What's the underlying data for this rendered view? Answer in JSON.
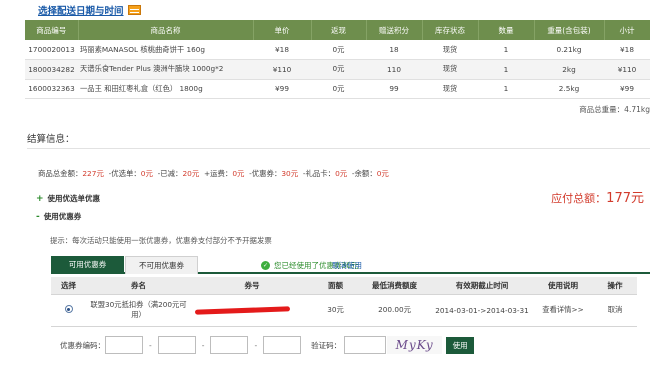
{
  "delivery_link": "选择配送日期与时间",
  "cart": {
    "headers": [
      "商品编号",
      "商品名称",
      "单价",
      "返现",
      "赠送积分",
      "库存状态",
      "数量",
      "重量(含包装)",
      "小计"
    ],
    "rows": [
      [
        "1700020013",
        "玛丽素MANASOL 核桃曲奇饼干 160g",
        "¥18",
        "0元",
        "18",
        "现货",
        "1",
        "0.21kg",
        "¥18"
      ],
      [
        "1800034282",
        "天谱乐食Tender Plus 澳洲牛腩块 1000g*2",
        "¥110",
        "0元",
        "110",
        "现货",
        "1",
        "2kg",
        "¥110"
      ],
      [
        "1600032363",
        "一品王 和田红枣礼盒（红色） 1800g",
        "¥99",
        "0元",
        "99",
        "现货",
        "1",
        "2.5kg",
        "¥99"
      ]
    ],
    "total_weight": "商品总重量：4.71kg"
  },
  "settle": {
    "title": "结算信息：",
    "summary": {
      "goods_label": "商品总金额：",
      "goods_value": "227元",
      "discount_label": "-优选单：",
      "discount_value": "0元",
      "cut_label": "-已减：",
      "cut_value": "20元",
      "shipping_label": "+运费：",
      "shipping_value": "0元",
      "coupon_label": "-优惠券：",
      "coupon_value": "30元",
      "giftcard_label": "-礼品卡：",
      "giftcard_value": "0元",
      "balance_label": "-余额：",
      "balance_value": "0元"
    },
    "use_order_coupon": "使用优选单优惠",
    "use_coupon": "使用优惠券",
    "due_label": "应付总额：",
    "due_value": "177元",
    "hint": "提示：每次活动只能使用一张优惠券，优惠券支付部分不予开据发票"
  },
  "coupon_tabs": {
    "active": "可用优惠券",
    "inactive": "不可用优惠券",
    "used_note": "您已经使用了优惠券30元",
    "cancel": "取消使用"
  },
  "coupon_table": {
    "headers": [
      "选择",
      "券名",
      "券号",
      "面额",
      "最低消费额度",
      "有效期截止时间",
      "使用说明",
      "操作"
    ],
    "row": {
      "name": "联盟30元抵扣券（满200元可用）",
      "value": "30元",
      "min": "200.00元",
      "period": "2014-03-01->2014-03-31",
      "detail": "查看详情>>",
      "action": "取消"
    }
  },
  "code_row": {
    "code_label": "优惠券编码：",
    "captcha_label": "验证码：",
    "captcha_text": "MyKy",
    "use_button": "使用"
  },
  "colors": {
    "header_green": "#6e8e4d",
    "tab_green": "#1c5a3a",
    "price_red": "#d23b2c",
    "link_blue": "#1a5aa8"
  }
}
